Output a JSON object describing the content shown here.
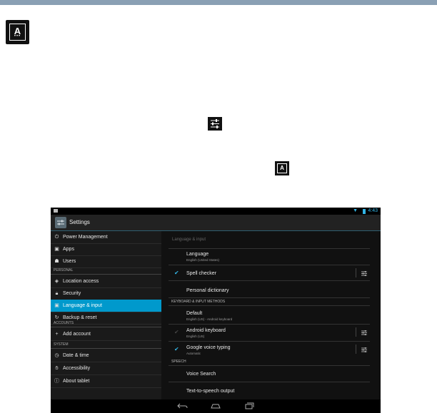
{
  "colors": {
    "accent": "#0099cc",
    "check": "#33b5e5",
    "topbar": "#8aa0b4"
  },
  "page_icons": {
    "app": "A",
    "inline_settings": "sliders-icon",
    "inline_app": "A"
  },
  "status_bar": {
    "time": "4:43"
  },
  "action_bar": {
    "title": "Settings"
  },
  "sidebar": {
    "items_top": [
      {
        "icon": "power-icon",
        "label": "Power Management"
      },
      {
        "icon": "apps-icon",
        "label": "Apps"
      },
      {
        "icon": "users-icon",
        "label": "Users"
      }
    ],
    "personal_header": "PERSONAL",
    "items_personal": [
      {
        "icon": "location-icon",
        "label": "Location access"
      },
      {
        "icon": "lock-icon",
        "label": "Security"
      },
      {
        "icon": "keyboard-icon",
        "label": "Language & input",
        "active": true
      },
      {
        "icon": "backup-icon",
        "label": "Backup & reset"
      }
    ],
    "accounts_header": "ACCOUNTS",
    "add_account": "Add account",
    "system_header": "SYSTEM",
    "items_system": [
      {
        "icon": "clock-icon",
        "label": "Date & time"
      },
      {
        "icon": "accessibility-icon",
        "label": "Accessibility"
      },
      {
        "icon": "info-icon",
        "label": "About tablet"
      }
    ]
  },
  "content": {
    "title": "Language & input",
    "language": {
      "title": "Language",
      "sub": "English (United States)"
    },
    "spell_checker": {
      "title": "Spell checker",
      "checked": true
    },
    "personal_dictionary": "Personal dictionary",
    "keyboard_header": "KEYBOARD & INPUT METHODS",
    "default": {
      "title": "Default",
      "sub": "English (US) - Android keyboard"
    },
    "android_keyboard": {
      "title": "Android keyboard",
      "sub": "English (US)",
      "checked": false
    },
    "google_voice": {
      "title": "Google voice typing",
      "sub": "Automatic",
      "checked": true
    },
    "speech_header": "SPEECH",
    "voice_search": "Voice Search",
    "tts": "Text-to-speech output"
  }
}
